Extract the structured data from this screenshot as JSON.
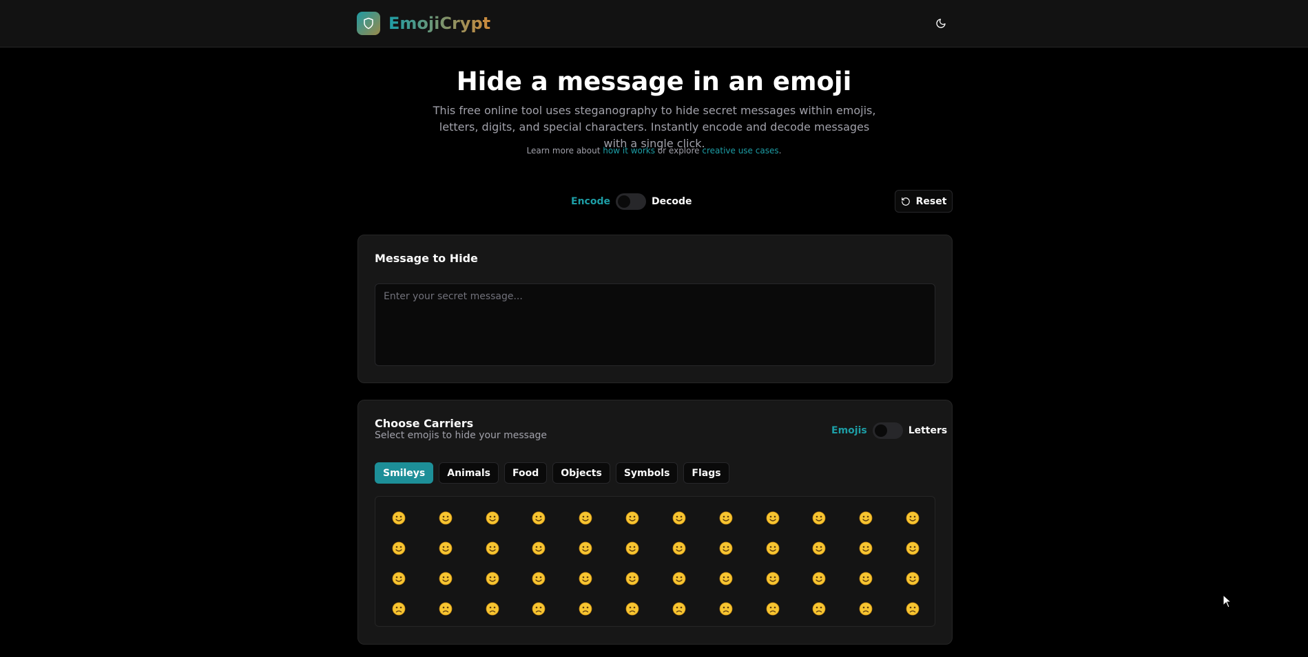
{
  "header": {
    "app_name": "EmojiCrypt",
    "logo_icon": "shield-icon",
    "theme_icon": "moon-icon"
  },
  "hero": {
    "title": "Hide a message in an emoji",
    "description": "This free online tool uses steganography to hide secret messages within emojis, letters, digits, and special characters. Instantly encode and decode messages with a single click.",
    "learn_prefix": "Learn more about ",
    "learn_link_1": "how it works",
    "learn_middle": " or explore ",
    "learn_link_2": "creative use cases",
    "learn_suffix": "."
  },
  "mode": {
    "encode_label": "Encode",
    "decode_label": "Decode",
    "active": "Encode",
    "reset_label": "Reset",
    "reset_icon": "rotate-ccw-icon"
  },
  "message": {
    "title": "Message to Hide",
    "placeholder": "Enter your secret message...",
    "value": ""
  },
  "carriers": {
    "title": "Choose Carriers",
    "subtitle": "Select emojis to hide your message",
    "emojis_label": "Emojis",
    "letters_label": "Letters",
    "active_type": "Emojis",
    "tabs": [
      "Smileys",
      "Animals",
      "Food",
      "Objects",
      "Symbols",
      "Flags"
    ],
    "active_tab": "Smileys",
    "emojis": [
      "😀",
      "😃",
      "😄",
      "😁",
      "😆",
      "😅",
      "😂",
      "🤣",
      "😊",
      "😇",
      "🙂",
      "🙃",
      "😉",
      "😌",
      "😍",
      "🥰",
      "😘",
      "😗",
      "😙",
      "😚",
      "😋",
      "😛",
      "😝",
      "😜",
      "🤪",
      "🤨",
      "🧐",
      "🤓",
      "😎",
      "🤩",
      "🥳",
      "😏",
      "😒",
      "😞",
      "😔",
      "😟",
      "😕",
      "🙁",
      "☹️",
      "😣",
      "😖",
      "😫",
      "😩",
      "🥺",
      "😢",
      "😭",
      "😤",
      "😠"
    ]
  },
  "colors": {
    "accent": "#1d9ea6",
    "background": "#000000",
    "card": "#171717"
  }
}
